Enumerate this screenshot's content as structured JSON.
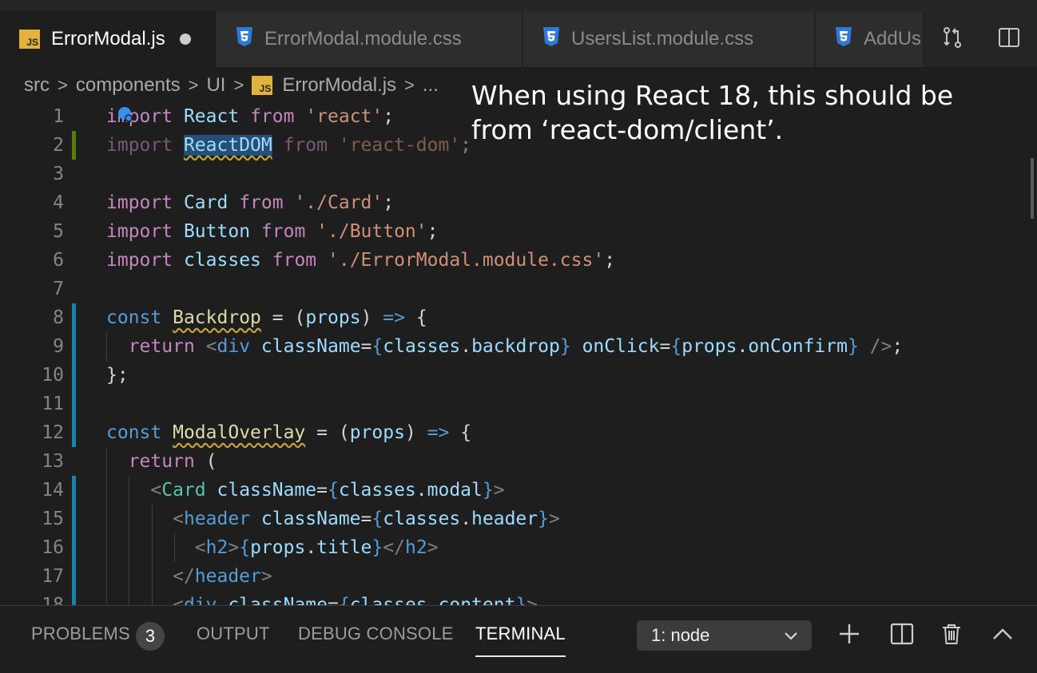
{
  "tabs": [
    {
      "label": "ErrorModal.js",
      "type": "js",
      "active": true,
      "dirty": true
    },
    {
      "label": "ErrorModal.module.css",
      "type": "css",
      "active": false
    },
    {
      "label": "UsersList.module.css",
      "type": "css",
      "active": false
    },
    {
      "label": "AddUs",
      "type": "css",
      "active": false
    }
  ],
  "file_icons": {
    "js": "JS",
    "css_icon": "css3-icon"
  },
  "breadcrumb": [
    "src",
    "components",
    "UI",
    "ErrorModal.js",
    "..."
  ],
  "editor": {
    "line_numbers": [
      "1",
      "2",
      "3",
      "4",
      "5",
      "6",
      "7",
      "8",
      "9",
      "10",
      "11",
      "12",
      "13",
      "14",
      "15",
      "16",
      "17",
      "18"
    ]
  },
  "overlay_note": {
    "line1": "When using React 18, this should be",
    "line2": "from ‘react-dom/client’."
  },
  "panel": {
    "tabs": [
      "PROBLEMS",
      "OUTPUT",
      "DEBUG CONSOLE",
      "TERMINAL"
    ],
    "problems_count": "3",
    "terminal_select": "1: node"
  },
  "colors": {
    "accent": "#1b81a8",
    "js_badge": "#e2b33a",
    "css_icon": "#2f7ad9",
    "keyword": "#c586c0",
    "string": "#ce9178",
    "variable": "#9cdcfe"
  }
}
